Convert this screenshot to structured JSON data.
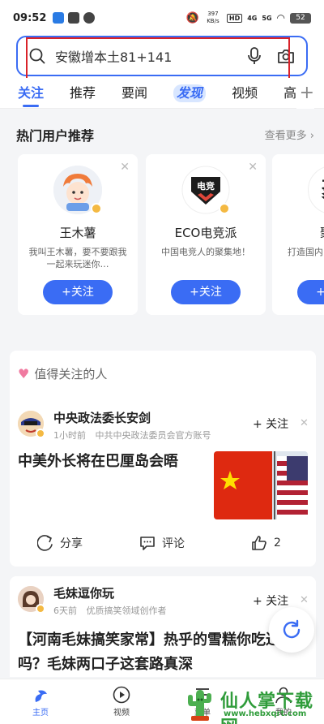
{
  "status_bar": {
    "time": "09:52",
    "network_speed": "397 KB/s",
    "hd_label": "HD",
    "net_4g": "4G",
    "net_5g": "5G",
    "battery": "52"
  },
  "search": {
    "query": "安徽增本土81+141"
  },
  "tabs": [
    {
      "label": "关注",
      "active": true
    },
    {
      "label": "推荐"
    },
    {
      "label": "要闻"
    },
    {
      "label": "发现"
    },
    {
      "label": "视频"
    },
    {
      "label": "高"
    }
  ],
  "hot_users": {
    "title": "热门用户推荐",
    "see_more": "查看更多",
    "follow_label": "+关注",
    "cards": [
      {
        "name": "王木薯",
        "desc": "我叫王木薯，要不要跟我一起来玩迷你…"
      },
      {
        "name": "ECO电竞派",
        "desc": "中国电竞人的聚集地！",
        "logo_text": "电竞"
      },
      {
        "name": "聚印",
        "desc": "打造国内…视频作品…",
        "logo_text": "聚"
      }
    ]
  },
  "worth_following": {
    "title": "值得关注的人",
    "follow_label": "+ 关注",
    "post1": {
      "author": "中央政法委长安剑",
      "time": "1小时前",
      "desc": "中共中央政法委员会官方账号",
      "headline": "中美外长将在巴厘岛会晤",
      "share_label": "分享",
      "comment_label": "评论",
      "like_count": "2"
    },
    "post2": {
      "author": "毛妹逗你玩",
      "time": "6天前",
      "desc": "优质搞笑领域创作者",
      "headline_line1": "【河南毛妹搞笑家常】热乎的雪糕你吃过",
      "headline_line2": "吗？毛妹两口子这套路真深"
    }
  },
  "bottom_nav": [
    {
      "label": "主页",
      "active": true
    },
    {
      "label": "视频"
    },
    {
      "label": "菜单"
    },
    {
      "label": "我的"
    }
  ],
  "watermark": {
    "text": "仙人掌下载网",
    "url": "www.hebxqrt.com"
  },
  "colors": {
    "accent": "#3a6cf4",
    "highlight_box": "#d9232a",
    "watermark": "#2f9c3a"
  }
}
